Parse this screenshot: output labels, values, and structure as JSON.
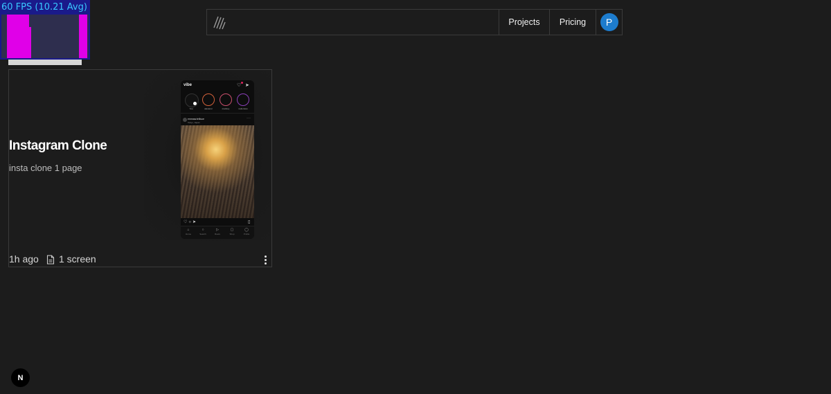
{
  "fps_overlay": {
    "label": "60 FPS (10.21 Avg)",
    "colors": {
      "background": "#1a1a8a",
      "text": "#38c8ff",
      "bar": "#e000e8"
    }
  },
  "nav": {
    "logo_icon": "diagonal-stripes-logo",
    "projects_label": "Projects",
    "pricing_label": "Pricing",
    "avatar_initial": "P",
    "avatar_color": "#1d7ccd"
  },
  "project_card": {
    "title": "Instagram Clone",
    "description": "insta clone 1 page",
    "time_ago": "1h ago",
    "screens_label": "1 screen",
    "doc_icon": "document-icon",
    "menu_icon": "more-vertical-icon",
    "preview": {
      "app_name": "vibe",
      "stories": [
        "You",
        "alexanor",
        "marina.j",
        "neilo.lives"
      ],
      "post_user": "emmaw.tellisoe",
      "post_location": "Tokyo, Japan",
      "tabs": [
        "Home",
        "Search",
        "Reels",
        "Shop",
        "Profile"
      ]
    }
  },
  "badge": {
    "label": "N"
  }
}
